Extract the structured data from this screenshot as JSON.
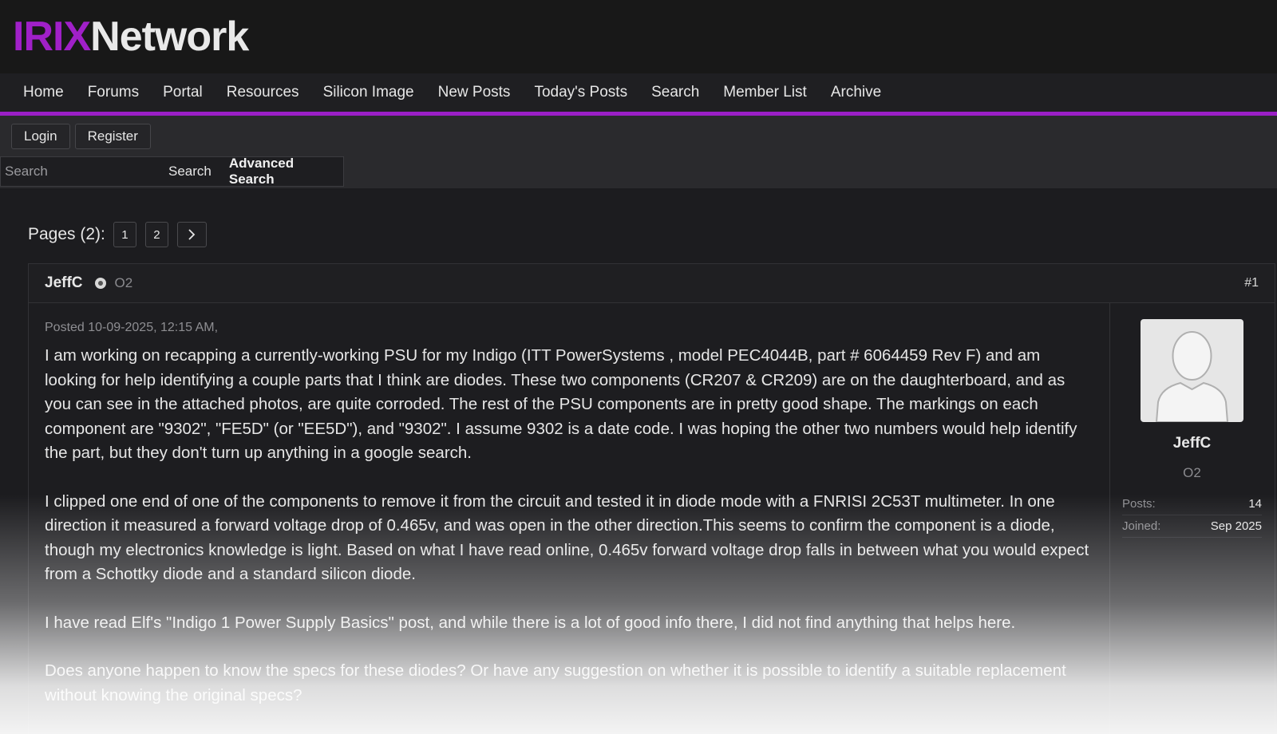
{
  "site": {
    "logo_part1": "IRIX",
    "logo_part2": "Network"
  },
  "nav": {
    "items": [
      {
        "label": "Home"
      },
      {
        "label": "Forums"
      },
      {
        "label": "Portal"
      },
      {
        "label": "Resources"
      },
      {
        "label": "Silicon Image"
      },
      {
        "label": "New Posts"
      },
      {
        "label": "Today's Posts"
      },
      {
        "label": "Search"
      },
      {
        "label": "Member List"
      },
      {
        "label": "Archive"
      }
    ]
  },
  "auth": {
    "login_label": "Login",
    "register_label": "Register"
  },
  "search": {
    "placeholder": "Search",
    "button_label": "Search",
    "advanced_label": "Advanced Search"
  },
  "pagination": {
    "label": "Pages (2):",
    "pages": [
      "1",
      "2"
    ],
    "next_icon": "chevron-right-icon"
  },
  "post": {
    "author": "JeffC",
    "rank": "O2",
    "number": "#1",
    "posted": "Posted 10-09-2025, 12:15 AM,",
    "paragraphs": [
      "I am working on recapping a currently-working PSU for my Indigo (ITT PowerSystems , model PEC4044B, part # 6064459 Rev F) and am looking for help identifying a couple parts that I think are diodes. These two components (CR207 & CR209) are on the daughterboard, and as you can see in the attached photos, are quite corroded. The rest of the PSU components are in pretty good shape. The markings on each component are \"9302\", \"FE5D\" (or \"EE5D\"), and \"9302\". I assume 9302 is a date code. I was hoping the other two numbers would help identify the part, but they don't turn up anything in a google search.",
      "I clipped one end of one of the components to remove it from the circuit and tested it in diode mode with a FNRISI 2C53T multimeter. In one direction it measured a forward voltage drop of 0.465v, and was open in the other direction.This seems to confirm the component is a diode, though my electronics knowledge is light. Based on what I have read online, 0.465v forward voltage drop falls in between what you would expect from a Schottky diode and a standard silicon diode.",
      "I have read Elf's \"Indigo 1 Power Supply Basics\" post, and while there is a lot of good info there, I did not find anything that helps here.",
      "Does anyone happen to know the specs for these diodes? Or have any suggestion on whether it is possible to identify a suitable replacement without knowing the original specs?"
    ]
  },
  "sidebar": {
    "name": "JeffC",
    "rank": "O2",
    "avatar_icon": "user-silhouette-icon",
    "posts_label": "Posts:",
    "posts_value": "14",
    "joined_label": "Joined:",
    "joined_value": "Sep 2025"
  },
  "colors": {
    "accent": "#9b1fc7",
    "background": "#1c1c1f"
  }
}
